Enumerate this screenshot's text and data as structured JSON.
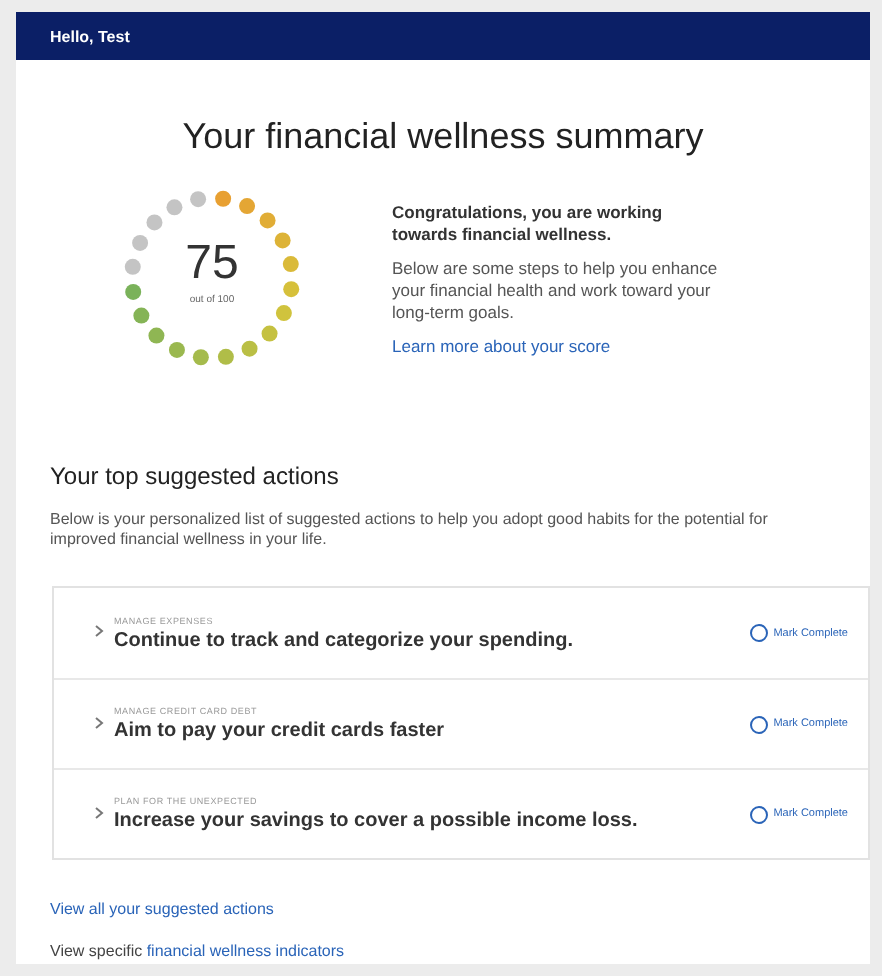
{
  "header": {
    "greeting": "Hello, Test"
  },
  "summary": {
    "title": "Your financial wellness summary",
    "score": "75",
    "score_caption": "out of 100",
    "level": 0.75,
    "headline": "Congratulations, you are working towards financial wellness.",
    "body": "Below are some steps to help you enhance your financial health and work toward your long-term goals.",
    "link": "Learn more about your score"
  },
  "actions": {
    "title": "Your top suggested actions",
    "description": "Below is your personalized list of suggested actions to help you adopt good habits for the potential for improved financial wellness in your life.",
    "items": [
      {
        "category": "MANAGE EXPENSES",
        "text": "Continue to track and categorize your spending.",
        "complete_label": "Mark Complete",
        "checked": false,
        "expanded": false
      },
      {
        "category": "MANAGE CREDIT CARD DEBT",
        "text": "Aim to pay your credit cards faster",
        "complete_label": "Mark Complete",
        "checked": false,
        "expanded": false
      },
      {
        "category": "PLAN FOR THE UNEXPECTED",
        "text": "Increase your savings to cover a possible income loss.",
        "complete_label": "Mark Complete",
        "checked": false,
        "expanded": false
      }
    ]
  },
  "footer": {
    "view_all": "View all your suggested actions",
    "indicators_prefix": "View specific",
    "indicators_link": "financial wellness indicators"
  }
}
